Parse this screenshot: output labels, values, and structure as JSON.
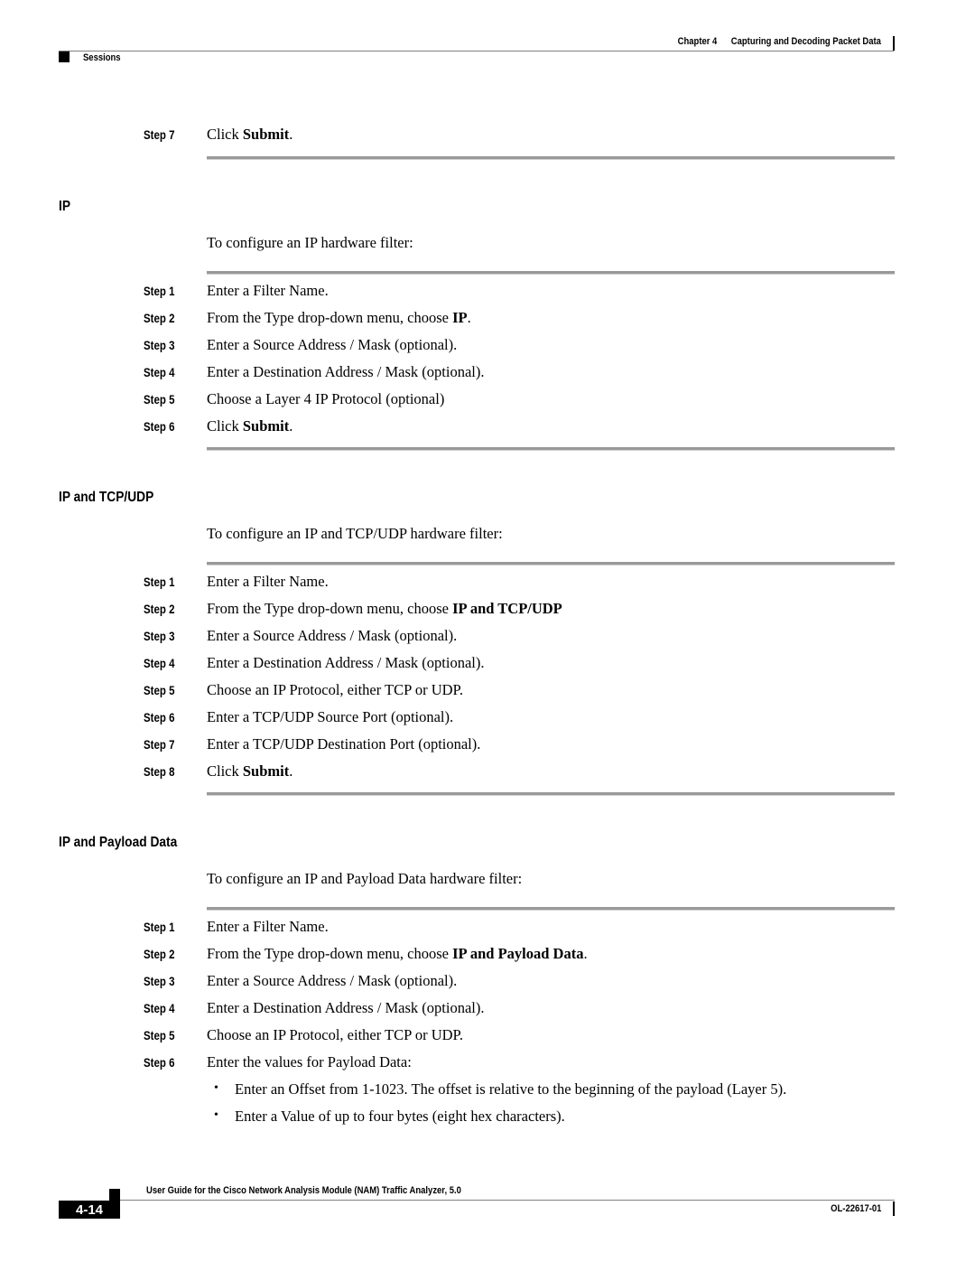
{
  "header": {
    "chapter_label": "Chapter 4",
    "chapter_title": "Capturing and Decoding Packet Data",
    "section": "Sessions"
  },
  "top_step": {
    "label": "Step 7",
    "prefix": "Click ",
    "bold": "Submit",
    "suffix": "."
  },
  "sections": [
    {
      "heading": "IP",
      "intro": "To configure an IP hardware filter:",
      "steps": [
        {
          "label": "Step 1",
          "prefix": "Enter a Filter Name.",
          "bold": "",
          "suffix": ""
        },
        {
          "label": "Step 2",
          "prefix": "From the Type drop-down menu, choose ",
          "bold": "IP",
          "suffix": "."
        },
        {
          "label": "Step 3",
          "prefix": "Enter a Source Address / Mask (optional).",
          "bold": "",
          "suffix": ""
        },
        {
          "label": "Step 4",
          "prefix": "Enter a Destination Address / Mask (optional).",
          "bold": "",
          "suffix": ""
        },
        {
          "label": "Step 5",
          "prefix": "Choose a Layer 4 IP Protocol (optional)",
          "bold": "",
          "suffix": ""
        },
        {
          "label": "Step 6",
          "prefix": "Click ",
          "bold": "Submit",
          "suffix": "."
        }
      ]
    },
    {
      "heading": "IP and TCP/UDP",
      "intro": "To configure an IP and TCP/UDP hardware filter:",
      "steps": [
        {
          "label": "Step 1",
          "prefix": "Enter a Filter Name.",
          "bold": "",
          "suffix": ""
        },
        {
          "label": "Step 2",
          "prefix": "From the Type drop-down menu, choose ",
          "bold": "IP and TCP/UDP",
          "suffix": ""
        },
        {
          "label": "Step 3",
          "prefix": "Enter a Source Address / Mask (optional).",
          "bold": "",
          "suffix": ""
        },
        {
          "label": "Step 4",
          "prefix": "Enter a Destination Address / Mask (optional).",
          "bold": "",
          "suffix": ""
        },
        {
          "label": "Step 5",
          "prefix": "Choose an IP Protocol, either TCP or UDP.",
          "bold": "",
          "suffix": ""
        },
        {
          "label": "Step 6",
          "prefix": "Enter a TCP/UDP Source Port (optional).",
          "bold": "",
          "suffix": ""
        },
        {
          "label": "Step 7",
          "prefix": "Enter a TCP/UDP Destination Port (optional).",
          "bold": "",
          "suffix": ""
        },
        {
          "label": "Step 8",
          "prefix": "Click ",
          "bold": "Submit",
          "suffix": "."
        }
      ]
    },
    {
      "heading": "IP and Payload Data",
      "intro": "To configure an IP and Payload Data hardware filter:",
      "steps": [
        {
          "label": "Step 1",
          "prefix": "Enter a Filter Name.",
          "bold": "",
          "suffix": ""
        },
        {
          "label": "Step 2",
          "prefix": "From the Type drop-down menu, choose ",
          "bold": "IP and Payload Data",
          "suffix": "."
        },
        {
          "label": "Step 3",
          "prefix": "Enter a Source Address / Mask (optional).",
          "bold": "",
          "suffix": ""
        },
        {
          "label": "Step 4",
          "prefix": "Enter a Destination Address / Mask (optional).",
          "bold": "",
          "suffix": ""
        },
        {
          "label": "Step 5",
          "prefix": "Choose an IP Protocol, either TCP or UDP.",
          "bold": "",
          "suffix": ""
        },
        {
          "label": "Step 6",
          "prefix": "Enter the values for Payload Data:",
          "bold": "",
          "suffix": ""
        }
      ],
      "bullets": [
        "Enter an Offset from 1-1023. The offset is relative to the beginning of the payload (Layer 5).",
        "Enter a Value of up to four bytes (eight hex characters)."
      ]
    }
  ],
  "footer": {
    "title": "User Guide for the Cisco Network Analysis Module (NAM) Traffic Analyzer, 5.0",
    "page_number": "4-14",
    "doc_number": "OL-22617-01"
  },
  "bullet_glyph": "•"
}
